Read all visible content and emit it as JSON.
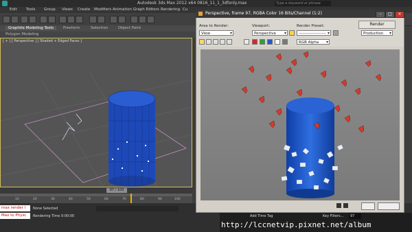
{
  "app": {
    "title": "Autodesk 3ds Max 2012 x64      0816_11_1_3dfonly.max",
    "search_placeholder": "Type a keyword or phrase"
  },
  "menu": [
    "Edit",
    "Tools",
    "Group",
    "Views",
    "Create",
    "Modifiers",
    "Animation",
    "Graph Editors",
    "Rendering",
    "Cu"
  ],
  "ribbon": {
    "tabs": [
      "Graphite Modeling Tools",
      "Freeform",
      "Selection",
      "Object Paint"
    ],
    "sub_label": "Polygon Modeling"
  },
  "viewport": {
    "label": "[ + ] [ Perspective ] [ Shaded + Edged Faces ]"
  },
  "timeline": {
    "frame_display": "97 / 100",
    "ticks": [
      "10",
      "20",
      "30",
      "40",
      "50",
      "60",
      "70",
      "80",
      "90",
      "100"
    ]
  },
  "status": {
    "maxscript_1": "max render l",
    "maxscript_2": "Max to Physc",
    "selection": "None Selected",
    "render_time": "Rendering Time  0:00:00",
    "add_time_tag": "Add Time Tag",
    "key_filters": "Key Filters...",
    "frame_field": "97"
  },
  "render_window": {
    "title": "Perspective, frame 97, RGBA Color 16 Bits/Channel (1:2)",
    "area_to_render_label": "Area to Render:",
    "area_to_render_value": "View",
    "viewport_label": "Viewport:",
    "viewport_value": "Perspective",
    "render_preset_label": "Render Preset:",
    "render_preset_value": "--------------------",
    "render_button": "Render",
    "production_value": "Production",
    "channel_value": "RGB Alpha"
  },
  "watermark": "http://lccnetvip.pixnet.net/album"
}
